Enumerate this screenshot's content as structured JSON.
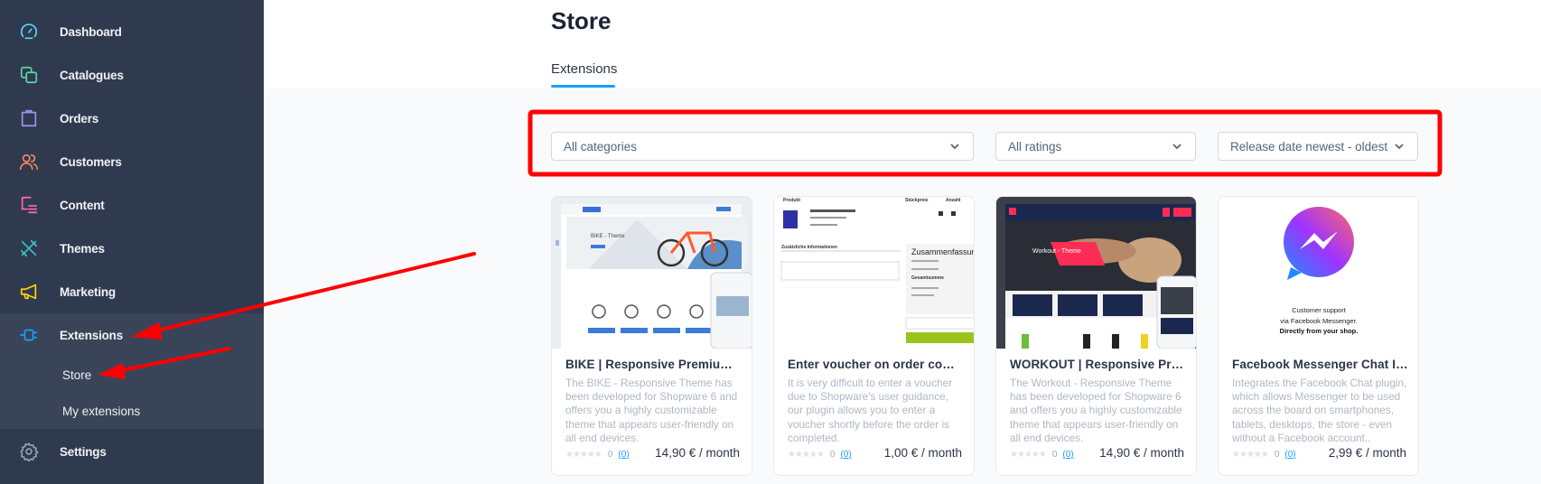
{
  "sidebar": {
    "items": [
      {
        "label": "Dashboard",
        "icon": "gauge-icon",
        "color": "#57d9f2"
      },
      {
        "label": "Catalogues",
        "icon": "catalogue-icon",
        "color": "#57d9a3"
      },
      {
        "label": "Orders",
        "icon": "shopping-bag-icon",
        "color": "#a092f0"
      },
      {
        "label": "Customers",
        "icon": "users-icon",
        "color": "#f88962"
      },
      {
        "label": "Content",
        "icon": "content-icon",
        "color": "#ff68b4"
      },
      {
        "label": "Themes",
        "icon": "paintbrush-icon",
        "color": "#3bc4c4"
      },
      {
        "label": "Marketing",
        "icon": "megaphone-icon",
        "color": "#ffd700"
      },
      {
        "label": "Extensions",
        "icon": "plug-icon",
        "color": "#189eff"
      },
      {
        "label": "Settings",
        "icon": "gear-icon",
        "color": "#9aa8b5"
      }
    ],
    "sub_items": [
      {
        "label": "Store"
      },
      {
        "label": "My extensions"
      }
    ]
  },
  "header": {
    "title": "Store",
    "tabs": [
      {
        "label": "Extensions",
        "active": true
      }
    ]
  },
  "filters": {
    "category": "All categories",
    "rating": "All ratings",
    "sort": "Release date newest - oldest"
  },
  "cards": [
    {
      "title": "BIKE | Responsive Premium T...",
      "description": "The BIKE - Responsive Theme has been developed for Shopware 6 and offers you a highly customizable theme that appears user-friendly on all end devices.",
      "rating": "0",
      "review_count": "(0)",
      "price": "14,90 € / month",
      "thumb_text": "BIKE - Theme"
    },
    {
      "title": "Enter voucher on order comp...",
      "description": "It is very difficult to enter a voucher due to Shopware's user guidance, our plugin allows you to enter a voucher shortly before the order is completed.",
      "rating": "0",
      "review_count": "(0)",
      "price": "1,00 € / month",
      "thumb_labels": {
        "col1": "Produkt",
        "col2": "Stückpreis",
        "col3": "Anzahl",
        "info": "Zusätzliche Informationen",
        "summary": "Zusammenfassung",
        "total": "Gesamtsumme"
      }
    },
    {
      "title": "WORKOUT | Responsive Prem...",
      "description": "The Workout - Responsive Theme has been developed for Shopware 6 and offers you a highly customizable theme that appears user-friendly on all end devices.",
      "rating": "0",
      "review_count": "(0)",
      "price": "14,90 € / month",
      "thumb_text": "Workout - Theme"
    },
    {
      "title": "Facebook Messenger Chat Int...",
      "description": "Integrates the Facebook Chat plugin, which allows Messenger to be used across the board on smartphones, tablets, desktops, the store - even without a Facebook account..",
      "rating": "0",
      "review_count": "(0)",
      "price": "2,99 € / month",
      "thumb_lines": [
        "Customer support",
        "via Facebook Messenger.",
        "Directly from your shop."
      ]
    }
  ],
  "colors": {
    "accent": "#189eff",
    "sidebar_bg": "#303a4f",
    "annotation": "#ff0000"
  }
}
